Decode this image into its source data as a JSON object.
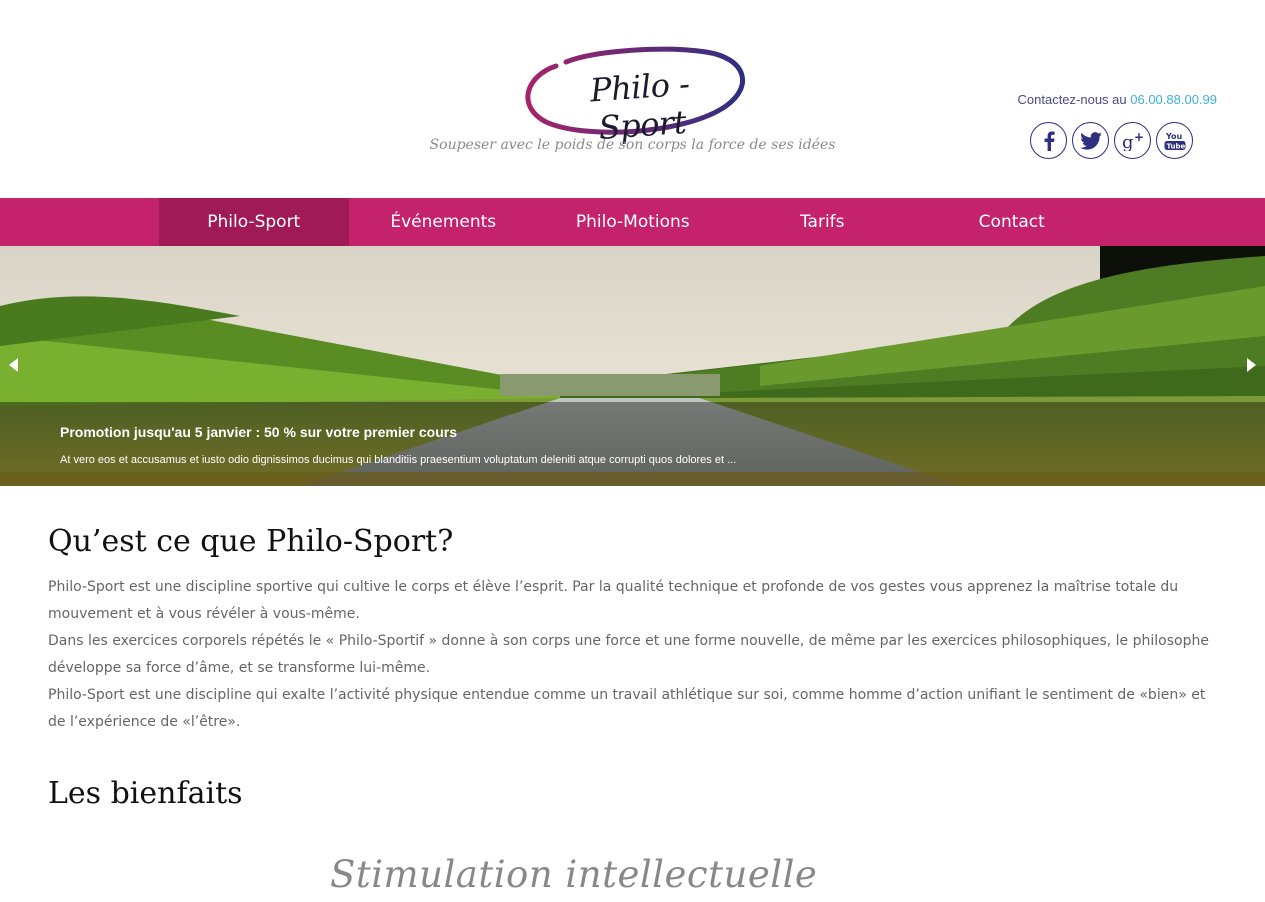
{
  "header": {
    "logo_text": "Philo - Sport",
    "tagline": "Soupeser avec le poids de son corps la force de ses idées",
    "contact_prefix": "Contactez-nous au",
    "contact_phone": "06.00.88.00.99",
    "socials": [
      {
        "name": "facebook",
        "icon": "facebook-icon"
      },
      {
        "name": "twitter",
        "icon": "twitter-icon"
      },
      {
        "name": "google-plus",
        "icon": "google-plus-icon"
      },
      {
        "name": "youtube",
        "icon": "youtube-icon"
      }
    ]
  },
  "nav": {
    "items": [
      {
        "label": "Philo-Sport",
        "active": true
      },
      {
        "label": "Événements",
        "active": false
      },
      {
        "label": "Philo-Motions",
        "active": false
      },
      {
        "label": "Tarifs",
        "active": false
      },
      {
        "label": "Contact",
        "active": false
      }
    ]
  },
  "slider": {
    "caption_title": "Promotion jusqu'au 5 janvier : 50 % sur votre premier cours",
    "caption_text": "At vero eos et accusamus et iusto odio dignissimos ducimus qui blanditiis praesentium voluptatum deleniti atque corrupti quos dolores et ..."
  },
  "main": {
    "section_title": "Qu’est ce que Philo-Sport?",
    "paragraphs": [
      "Philo-Sport est une discipline sportive qui cultive le corps et élève l’esprit. Par la qualité technique et profonde de vos gestes vous apprenez la maîtrise totale du mouvement et à vous révéler à vous-même.",
      "Dans les exercices corporels répétés le « Philo-Sportif » donne à son corps une force et une forme nouvelle, de même par les exercices philosophiques, le philosophe développe sa force d’âme, et se transforme lui-même.",
      "Philo-Sport est une discipline qui exalte l’activité physique entendue comme un travail athlétique sur soi, comme homme d’action unifiant le sentiment de «bien» et de l’expérience de «l’être»."
    ],
    "benefits_title": "Les bienfaits",
    "benefit_heading": "Stimulation  intellectuelle"
  },
  "colors": {
    "nav_bg": "#c4226d",
    "nav_active": "#a01a57",
    "phone": "#3fb0d8",
    "social": "#2e2f7f"
  }
}
